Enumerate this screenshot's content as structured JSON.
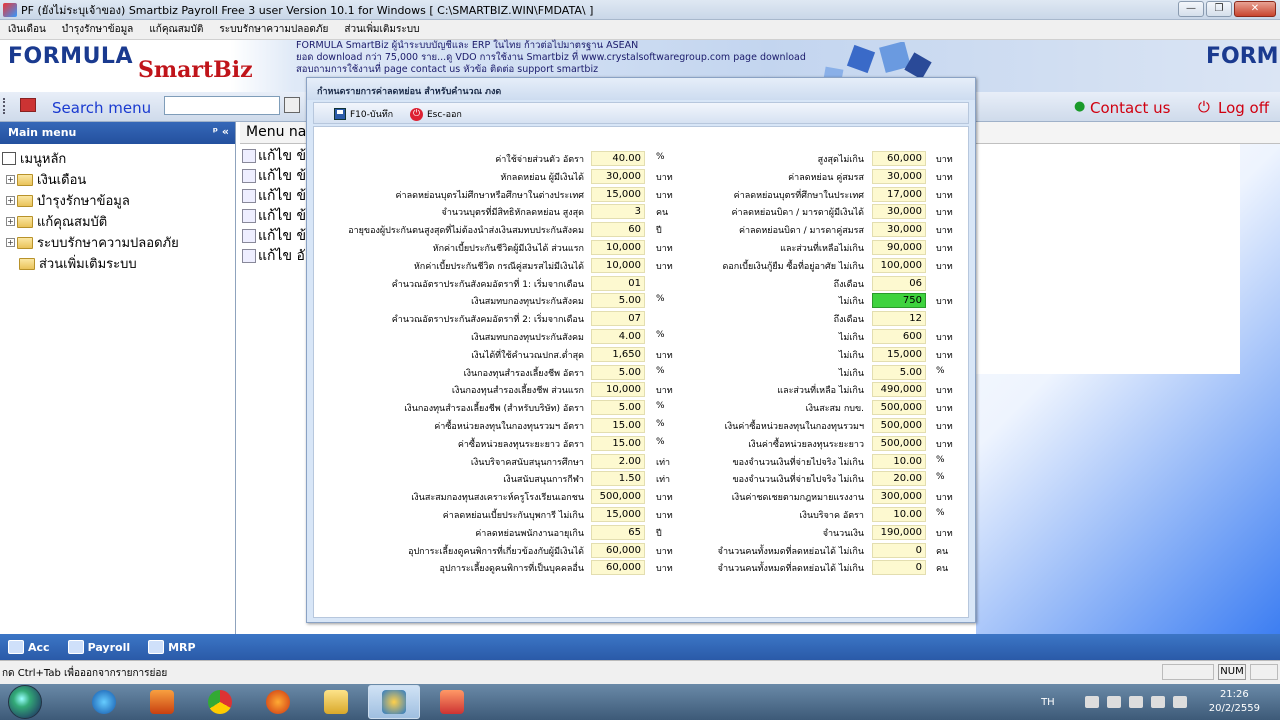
{
  "window": {
    "title": "PF (ยังไม่ระบุเจ้าของ) Smartbiz Payroll Free 3 user Version 10.1 for Windows [ C:\\SMARTBIZ.WIN\\FMDATA\\ ]"
  },
  "menubar": {
    "items": [
      "เงินเดือน",
      "บำรุงรักษาข้อมูล",
      "แก้คุณสมบัติ",
      "ระบบรักษาความปลอดภัย",
      "ส่วนเพิ่มเติมระบบ"
    ]
  },
  "banner": {
    "logo_left_1": "FORMULA",
    "logo_left_2": "SmartBiz",
    "line1": "FORMULA SmartBiz ผู้นำระบบบัญชีและ ERP ในไทย ก้าวต่อไปมาตรฐาน ASEAN",
    "line2": "ยอด download กว่า 75,000 ราย...ดู VDO การใช้งาน Smartbiz ที่ www.crystalsoftwaregroup.com page download",
    "line3": "สอบถามการใช้งานที่ page contact us หัวข้อ ติดต่อ support smartbiz",
    "logo_right": "FORM"
  },
  "toolbar": {
    "search_label": "Search menu",
    "search_value": "",
    "contact": "Contact us",
    "logoff": "Log off"
  },
  "mainmenu": {
    "header": "Main menu",
    "pin": "ᵖ «",
    "root": "เมนูหลัก",
    "items": [
      "เงินเดือน",
      "บำรุงรักษาข้อมูล",
      "แก้คุณสมบัติ",
      "ระบบรักษาความปลอดภัย",
      "ส่วนเพิ่มเติมระบบ"
    ]
  },
  "panel": {
    "header": "Menu nar",
    "rows": [
      "แก้ไข ข้อ",
      "แก้ไข ข้อ",
      "แก้ไข ข้อ",
      "แก้ไข ข้อ",
      "แก้ไข ข้อ",
      "แก้ไข อัต"
    ]
  },
  "dialog": {
    "title": "กำหนดรายการค่าลดหย่อน สำหรับคำนวณ ภงด",
    "save_label": "F10-บันทึก",
    "esc_label": "Esc-ออก",
    "left": [
      {
        "label": "ค่าใช้จ่ายส่วนตัว อัตรา",
        "value": "40.00",
        "unit": "%"
      },
      {
        "label": "หักลดหย่อน ผู้มีเงินได้",
        "value": "30,000",
        "unit": "บาท"
      },
      {
        "label": "ค่าลดหย่อนบุตรไม่ศึกษาหรือศึกษาในต่างประเทศ",
        "value": "15,000",
        "unit": "บาท"
      },
      {
        "label": "จำนวนบุตรที่มีสิทธิหักลดหย่อน สูงสุด",
        "value": "3",
        "unit": "คน"
      },
      {
        "label": "อายุของผู้ประกันตนสูงสุดที่ไม่ต้องนำส่งเงินสมทบประกันสังคม",
        "value": "60",
        "unit": "ปี"
      },
      {
        "label": "หักค่าเบี้ยประกันชีวิตผู้มีเงินได้ ส่วนแรก",
        "value": "10,000",
        "unit": "บาท"
      },
      {
        "label": "หักค่าเบี้ยประกันชีวิต กรณีคู่สมรสไม่มีเงินได้",
        "value": "10,000",
        "unit": "บาท"
      },
      {
        "label": "คำนวณอัตราประกันสังคมอัตราที่ 1: เริ่มจากเดือน",
        "value": "01",
        "unit": ""
      },
      {
        "label": "เงินสมทบกองทุนประกันสังคม",
        "value": "5.00",
        "unit": "%"
      },
      {
        "label": "คำนวณอัตราประกันสังคมอัตราที่ 2: เริ่มจากเดือน",
        "value": "07",
        "unit": ""
      },
      {
        "label": "เงินสมทบกองทุนประกันสังคม",
        "value": "4.00",
        "unit": "%"
      },
      {
        "label": "เงินได้ที่ใช้คำนวณปกส.ต่ำสุด",
        "value": "1,650",
        "unit": "บาท"
      },
      {
        "label": "เงินกองทุนสำรองเลี้ยงชีพ อัตรา",
        "value": "5.00",
        "unit": "%"
      },
      {
        "label": "เงินกองทุนสำรองเลี้ยงชีพ ส่วนแรก",
        "value": "10,000",
        "unit": "บาท"
      },
      {
        "label": "เงินกองทุนสำรองเลี้ยงชีพ (สำหรับบริษัท) อัตรา",
        "value": "5.00",
        "unit": "%"
      },
      {
        "label": "ค่าซื้อหน่วยลงทุนในกองทุนรวมฯ อัตรา",
        "value": "15.00",
        "unit": "%"
      },
      {
        "label": "ค่าซื้อหน่วยลงทุนระยะยาว อัตรา",
        "value": "15.00",
        "unit": "%"
      },
      {
        "label": "เงินบริจาคสนับสนุนการศึกษา",
        "value": "2.00",
        "unit": "เท่า"
      },
      {
        "label": "เงินสนับสนุนการกีฬา",
        "value": "1.50",
        "unit": "เท่า"
      },
      {
        "label": "เงินสะสมกองทุนสงเคราะห์ครูโรงเรียนเอกชน",
        "value": "500,000",
        "unit": "บาท"
      },
      {
        "label": "ค่าลดหย่อนเบี้ยประกันบุพการี ไม่เกิน",
        "value": "15,000",
        "unit": "บาท"
      },
      {
        "label": "ค่าลดหย่อนพนักงานอายุเกิน",
        "value": "65",
        "unit": "ปี"
      },
      {
        "label": "อุปการะเลี้ยงดูคนพิการที่เกี่ยวข้องกับผู้มีเงินได้",
        "value": "60,000",
        "unit": "บาท"
      },
      {
        "label": "อุปการะเลี้ยงดูคนพิการที่เป็นบุคคลอื่น",
        "value": "60,000",
        "unit": "บาท"
      }
    ],
    "right": [
      {
        "label": "สูงสุดไม่เกิน",
        "value": "60,000",
        "unit": "บาท"
      },
      {
        "label": "ค่าลดหย่อน คู่สมรส",
        "value": "30,000",
        "unit": "บาท"
      },
      {
        "label": "ค่าลดหย่อนบุตรที่ศึกษาในประเทศ",
        "value": "17,000",
        "unit": "บาท"
      },
      {
        "label": "ค่าลดหย่อนบิดา / มารดาผู้มีเงินได้",
        "value": "30,000",
        "unit": "บาท"
      },
      {
        "label": "ค่าลดหย่อนบิดา / มารดาคู่สมรส",
        "value": "30,000",
        "unit": "บาท"
      },
      {
        "label": "และส่วนที่เหลือไม่เกิน",
        "value": "90,000",
        "unit": "บาท"
      },
      {
        "label": "ดอกเบี้ยเงินกู้ยืม ซื้อที่อยู่อาศัย ไม่เกิน",
        "value": "100,000",
        "unit": "บาท"
      },
      {
        "label": "ถึงเดือน",
        "value": "06",
        "unit": ""
      },
      {
        "label": "ไม่เกิน",
        "value": "750",
        "unit": "บาท"
      },
      {
        "label": "ถึงเดือน",
        "value": "12",
        "unit": ""
      },
      {
        "label": "ไม่เกิน",
        "value": "600",
        "unit": "บาท"
      },
      {
        "label": "ไม่เกิน",
        "value": "15,000",
        "unit": "บาท"
      },
      {
        "label": "ไม่เกิน",
        "value": "5.00",
        "unit": "%"
      },
      {
        "label": "และส่วนที่เหลือ ไม่เกิน",
        "value": "490,000",
        "unit": "บาท"
      },
      {
        "label": "เงินสะสม กบข.",
        "value": "500,000",
        "unit": "บาท"
      },
      {
        "label": "เงินค่าซื้อหน่วยลงทุนในกองทุนรวมฯ",
        "value": "500,000",
        "unit": "บาท"
      },
      {
        "label": "เงินค่าซื้อหน่วยลงทุนระยะยาว",
        "value": "500,000",
        "unit": "บาท"
      },
      {
        "label": "ของจำนวนเงินที่จ่ายไปจริง ไม่เกิน",
        "value": "10.00",
        "unit": "%"
      },
      {
        "label": "ของจำนวนเงินที่จ่ายไปจริง ไม่เกิน",
        "value": "20.00",
        "unit": "%"
      },
      {
        "label": "เงินค่าชดเชยตามกฎหมายแรงงาน",
        "value": "300,000",
        "unit": "บาท"
      },
      {
        "label": "เงินบริจาค อัตรา",
        "value": "10.00",
        "unit": "%"
      },
      {
        "label": "จำนวนเงิน",
        "value": "190,000",
        "unit": "บาท"
      },
      {
        "label": "จำนวนคนทั้งหมดที่ลดหย่อนได้ ไม่เกิน",
        "value": "0",
        "unit": "คน"
      },
      {
        "label": "จำนวนคนทั้งหมดที่ลดหย่อนได้ ไม่เกิน",
        "value": "0",
        "unit": "คน"
      }
    ]
  },
  "bottomnav": {
    "items": [
      "Acc",
      "Payroll",
      "MRP"
    ]
  },
  "statusbar": {
    "text": "กด Ctrl+Tab เพื่อออกจากรายการย่อย",
    "num": "NUM"
  },
  "taskbar": {
    "lang": "TH",
    "time": "21:26",
    "date": "20/2/2559"
  },
  "colors": {
    "accent": "#24509e",
    "highlight": "#3ed33e",
    "field": "#fdf9d0",
    "link_red": "#d00010"
  }
}
